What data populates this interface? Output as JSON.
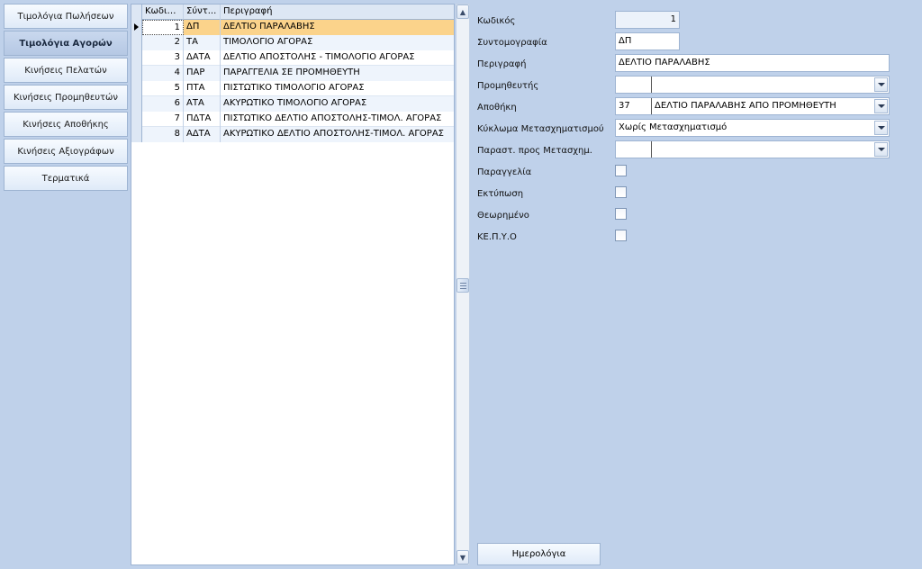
{
  "nav": {
    "items": [
      {
        "label": "Τιμολόγια Πωλήσεων"
      },
      {
        "label": "Τιμολόγια Αγορών"
      },
      {
        "label": "Κινήσεις Πελατών"
      },
      {
        "label": "Κινήσεις Προμηθευτών"
      },
      {
        "label": "Κινήσεις Αποθήκης"
      },
      {
        "label": "Κινήσεις Αξιογράφων"
      },
      {
        "label": "Τερματικά"
      }
    ],
    "active_index": 1
  },
  "grid": {
    "columns": [
      "Κωδικός",
      "Σύντ...",
      "Περιγραφή"
    ],
    "rows": [
      {
        "code": "1",
        "abbr": "ΔΠ",
        "desc": "ΔΕΛΤΙΟ ΠΑΡΑΛΑΒΗΣ"
      },
      {
        "code": "2",
        "abbr": "ΤΑ",
        "desc": "ΤΙΜΟΛΟΓΙΟ ΑΓΟΡΑΣ"
      },
      {
        "code": "3",
        "abbr": "ΔΑΤΑ",
        "desc": "ΔΕΛΤΙΟ ΑΠΟΣΤΟΛΗΣ - ΤΙΜΟΛΟΓΙΟ ΑΓΟΡΑΣ"
      },
      {
        "code": "4",
        "abbr": "ΠΑΡ",
        "desc": "ΠΑΡΑΓΓΕΛΙΑ ΣΕ ΠΡΟΜΗΘΕΥΤΗ"
      },
      {
        "code": "5",
        "abbr": "ΠΤΑ",
        "desc": "ΠΙΣΤΩΤΙΚΟ ΤΙΜΟΛΟΓΙΟ ΑΓΟΡΑΣ"
      },
      {
        "code": "6",
        "abbr": "ΑΤΑ",
        "desc": "ΑΚΥΡΩΤΙΚΟ ΤΙΜΟΛΟΓΙΟ ΑΓΟΡΑΣ"
      },
      {
        "code": "7",
        "abbr": "ΠΔΤΑ",
        "desc": "ΠΙΣΤΩΤΙΚΟ ΔΕΛΤΙΟ ΑΠΟΣΤΟΛΗΣ-ΤΙΜΟΛ. ΑΓΟΡΑΣ"
      },
      {
        "code": "8",
        "abbr": "ΑΔΤΑ",
        "desc": "ΑΚΥΡΩΤΙΚΟ ΔΕΛΤΙΟ ΑΠΟΣΤΟΛΗΣ-ΤΙΜΟΛ. ΑΓΟΡΑΣ"
      }
    ],
    "selected_index": 0
  },
  "form": {
    "code_label": "Κωδικός",
    "code_value": "1",
    "abbr_label": "Συντομογραφία",
    "abbr_value": "ΔΠ",
    "desc_label": "Περιγραφή",
    "desc_value": "ΔΕΛΤΙΟ ΠΑΡΑΛΑΒΗΣ",
    "supplier_label": "Προμηθευτής",
    "supplier_code": "",
    "supplier_name": "",
    "warehouse_label": "Αποθήκη",
    "warehouse_code": "37",
    "warehouse_name": "ΔΕΛΤΙΟ ΠΑΡΑΛΑΒΗΣ ΑΠΟ ΠΡΟΜΗΘΕΥΤΗ",
    "cycle_label": "Κύκλωμα Μετασχηματισμού",
    "cycle_value": "Χωρίς Μετασχηματισμό",
    "transform_doc_label": "Παραστ. προς Μετασχημ.",
    "transform_doc_code": "",
    "transform_doc_name": "",
    "order_label": "Παραγγελία",
    "order_checked": false,
    "print_label": "Εκτύπωση",
    "print_checked": false,
    "approved_label": "Θεωρημένο",
    "approved_checked": false,
    "kepyo_label": "ΚΕ.Π.Υ.Ο",
    "kepyo_checked": false
  },
  "buttons": {
    "journals_label": "Ημερολόγια"
  }
}
